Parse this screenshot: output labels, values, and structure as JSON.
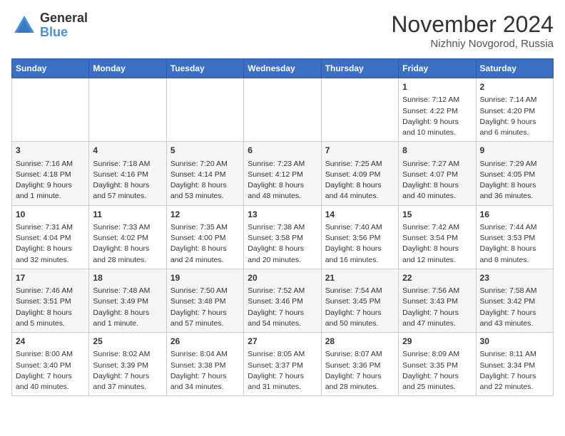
{
  "header": {
    "logo_general": "General",
    "logo_blue": "Blue",
    "month_title": "November 2024",
    "location": "Nizhniy Novgorod, Russia"
  },
  "days_of_week": [
    "Sunday",
    "Monday",
    "Tuesday",
    "Wednesday",
    "Thursday",
    "Friday",
    "Saturday"
  ],
  "weeks": [
    [
      {
        "day": "",
        "data": ""
      },
      {
        "day": "",
        "data": ""
      },
      {
        "day": "",
        "data": ""
      },
      {
        "day": "",
        "data": ""
      },
      {
        "day": "",
        "data": ""
      },
      {
        "day": "1",
        "data": "Sunrise: 7:12 AM\nSunset: 4:22 PM\nDaylight: 9 hours and 10 minutes."
      },
      {
        "day": "2",
        "data": "Sunrise: 7:14 AM\nSunset: 4:20 PM\nDaylight: 9 hours and 6 minutes."
      }
    ],
    [
      {
        "day": "3",
        "data": "Sunrise: 7:16 AM\nSunset: 4:18 PM\nDaylight: 9 hours and 1 minute."
      },
      {
        "day": "4",
        "data": "Sunrise: 7:18 AM\nSunset: 4:16 PM\nDaylight: 8 hours and 57 minutes."
      },
      {
        "day": "5",
        "data": "Sunrise: 7:20 AM\nSunset: 4:14 PM\nDaylight: 8 hours and 53 minutes."
      },
      {
        "day": "6",
        "data": "Sunrise: 7:23 AM\nSunset: 4:12 PM\nDaylight: 8 hours and 48 minutes."
      },
      {
        "day": "7",
        "data": "Sunrise: 7:25 AM\nSunset: 4:09 PM\nDaylight: 8 hours and 44 minutes."
      },
      {
        "day": "8",
        "data": "Sunrise: 7:27 AM\nSunset: 4:07 PM\nDaylight: 8 hours and 40 minutes."
      },
      {
        "day": "9",
        "data": "Sunrise: 7:29 AM\nSunset: 4:05 PM\nDaylight: 8 hours and 36 minutes."
      }
    ],
    [
      {
        "day": "10",
        "data": "Sunrise: 7:31 AM\nSunset: 4:04 PM\nDaylight: 8 hours and 32 minutes."
      },
      {
        "day": "11",
        "data": "Sunrise: 7:33 AM\nSunset: 4:02 PM\nDaylight: 8 hours and 28 minutes."
      },
      {
        "day": "12",
        "data": "Sunrise: 7:35 AM\nSunset: 4:00 PM\nDaylight: 8 hours and 24 minutes."
      },
      {
        "day": "13",
        "data": "Sunrise: 7:38 AM\nSunset: 3:58 PM\nDaylight: 8 hours and 20 minutes."
      },
      {
        "day": "14",
        "data": "Sunrise: 7:40 AM\nSunset: 3:56 PM\nDaylight: 8 hours and 16 minutes."
      },
      {
        "day": "15",
        "data": "Sunrise: 7:42 AM\nSunset: 3:54 PM\nDaylight: 8 hours and 12 minutes."
      },
      {
        "day": "16",
        "data": "Sunrise: 7:44 AM\nSunset: 3:53 PM\nDaylight: 8 hours and 8 minutes."
      }
    ],
    [
      {
        "day": "17",
        "data": "Sunrise: 7:46 AM\nSunset: 3:51 PM\nDaylight: 8 hours and 5 minutes."
      },
      {
        "day": "18",
        "data": "Sunrise: 7:48 AM\nSunset: 3:49 PM\nDaylight: 8 hours and 1 minute."
      },
      {
        "day": "19",
        "data": "Sunrise: 7:50 AM\nSunset: 3:48 PM\nDaylight: 7 hours and 57 minutes."
      },
      {
        "day": "20",
        "data": "Sunrise: 7:52 AM\nSunset: 3:46 PM\nDaylight: 7 hours and 54 minutes."
      },
      {
        "day": "21",
        "data": "Sunrise: 7:54 AM\nSunset: 3:45 PM\nDaylight: 7 hours and 50 minutes."
      },
      {
        "day": "22",
        "data": "Sunrise: 7:56 AM\nSunset: 3:43 PM\nDaylight: 7 hours and 47 minutes."
      },
      {
        "day": "23",
        "data": "Sunrise: 7:58 AM\nSunset: 3:42 PM\nDaylight: 7 hours and 43 minutes."
      }
    ],
    [
      {
        "day": "24",
        "data": "Sunrise: 8:00 AM\nSunset: 3:40 PM\nDaylight: 7 hours and 40 minutes."
      },
      {
        "day": "25",
        "data": "Sunrise: 8:02 AM\nSunset: 3:39 PM\nDaylight: 7 hours and 37 minutes."
      },
      {
        "day": "26",
        "data": "Sunrise: 8:04 AM\nSunset: 3:38 PM\nDaylight: 7 hours and 34 minutes."
      },
      {
        "day": "27",
        "data": "Sunrise: 8:05 AM\nSunset: 3:37 PM\nDaylight: 7 hours and 31 minutes."
      },
      {
        "day": "28",
        "data": "Sunrise: 8:07 AM\nSunset: 3:36 PM\nDaylight: 7 hours and 28 minutes."
      },
      {
        "day": "29",
        "data": "Sunrise: 8:09 AM\nSunset: 3:35 PM\nDaylight: 7 hours and 25 minutes."
      },
      {
        "day": "30",
        "data": "Sunrise: 8:11 AM\nSunset: 3:34 PM\nDaylight: 7 hours and 22 minutes."
      }
    ]
  ]
}
